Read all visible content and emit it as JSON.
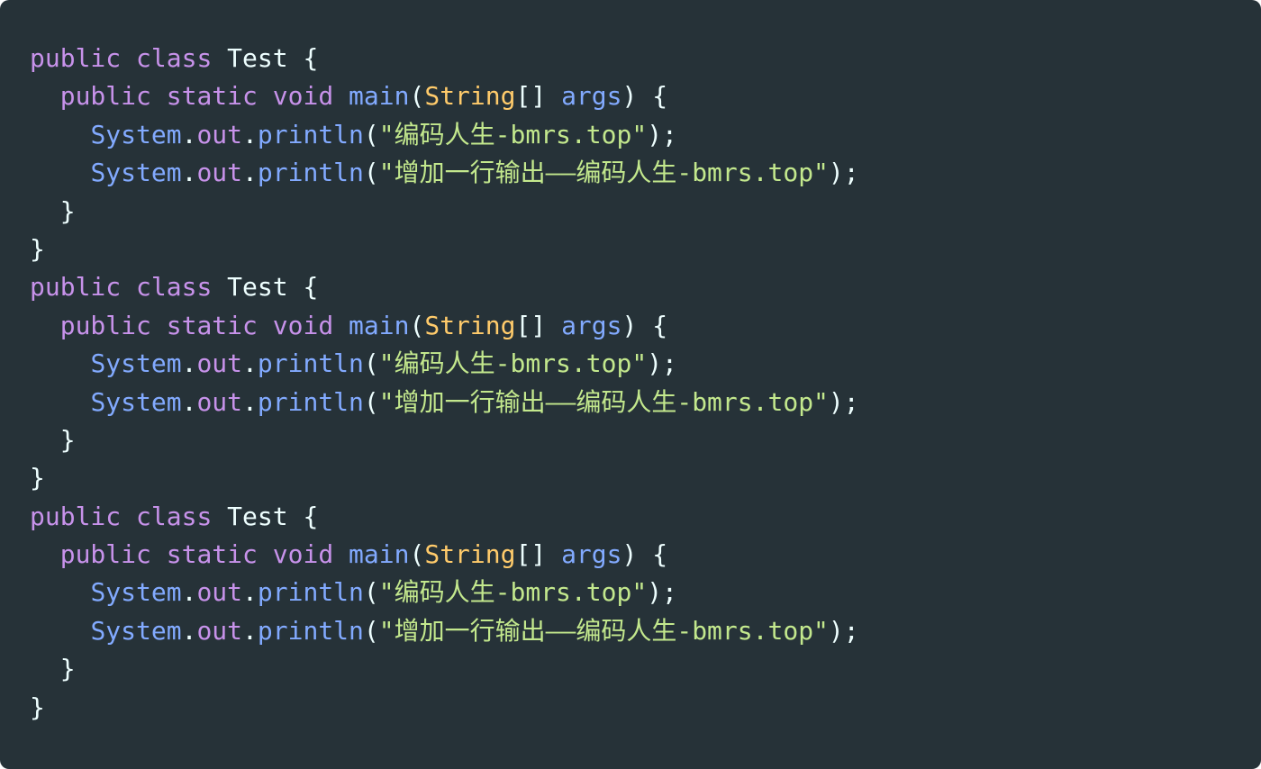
{
  "colors": {
    "background": "#263238",
    "keyword": "#c792ea",
    "type": "#ffcb6b",
    "function": "#82aaff",
    "string": "#c3e88d",
    "plain": "#eeffff"
  },
  "code": {
    "lines": [
      [
        {
          "t": "kw",
          "v": "public"
        },
        {
          "t": "plain",
          "v": " "
        },
        {
          "t": "kw",
          "v": "class"
        },
        {
          "t": "plain",
          "v": " Test {"
        }
      ],
      [
        {
          "t": "plain",
          "v": "  "
        },
        {
          "t": "kw",
          "v": "public"
        },
        {
          "t": "plain",
          "v": " "
        },
        {
          "t": "kw",
          "v": "static"
        },
        {
          "t": "plain",
          "v": " "
        },
        {
          "t": "kw",
          "v": "void"
        },
        {
          "t": "plain",
          "v": " "
        },
        {
          "t": "fn",
          "v": "main"
        },
        {
          "t": "plain",
          "v": "("
        },
        {
          "t": "type",
          "v": "String"
        },
        {
          "t": "plain",
          "v": "[] "
        },
        {
          "t": "fn",
          "v": "args"
        },
        {
          "t": "plain",
          "v": ") {"
        }
      ],
      [
        {
          "t": "plain",
          "v": "    "
        },
        {
          "t": "fn",
          "v": "System"
        },
        {
          "t": "plain",
          "v": "."
        },
        {
          "t": "kw",
          "v": "out"
        },
        {
          "t": "plain",
          "v": "."
        },
        {
          "t": "fn",
          "v": "println"
        },
        {
          "t": "plain",
          "v": "("
        },
        {
          "t": "str",
          "v": "\"编码人生-bmrs.top\""
        },
        {
          "t": "plain",
          "v": ");"
        }
      ],
      [
        {
          "t": "plain",
          "v": "    "
        },
        {
          "t": "fn",
          "v": "System"
        },
        {
          "t": "plain",
          "v": "."
        },
        {
          "t": "kw",
          "v": "out"
        },
        {
          "t": "plain",
          "v": "."
        },
        {
          "t": "fn",
          "v": "println"
        },
        {
          "t": "plain",
          "v": "("
        },
        {
          "t": "str",
          "v": "\"增加一行输出——编码人生-bmrs.top\""
        },
        {
          "t": "plain",
          "v": ");"
        }
      ],
      [
        {
          "t": "plain",
          "v": "  }"
        }
      ],
      [
        {
          "t": "plain",
          "v": "}"
        }
      ],
      [
        {
          "t": "kw",
          "v": "public"
        },
        {
          "t": "plain",
          "v": " "
        },
        {
          "t": "kw",
          "v": "class"
        },
        {
          "t": "plain",
          "v": " Test {"
        }
      ],
      [
        {
          "t": "plain",
          "v": "  "
        },
        {
          "t": "kw",
          "v": "public"
        },
        {
          "t": "plain",
          "v": " "
        },
        {
          "t": "kw",
          "v": "static"
        },
        {
          "t": "plain",
          "v": " "
        },
        {
          "t": "kw",
          "v": "void"
        },
        {
          "t": "plain",
          "v": " "
        },
        {
          "t": "fn",
          "v": "main"
        },
        {
          "t": "plain",
          "v": "("
        },
        {
          "t": "type",
          "v": "String"
        },
        {
          "t": "plain",
          "v": "[] "
        },
        {
          "t": "fn",
          "v": "args"
        },
        {
          "t": "plain",
          "v": ") {"
        }
      ],
      [
        {
          "t": "plain",
          "v": "    "
        },
        {
          "t": "fn",
          "v": "System"
        },
        {
          "t": "plain",
          "v": "."
        },
        {
          "t": "kw",
          "v": "out"
        },
        {
          "t": "plain",
          "v": "."
        },
        {
          "t": "fn",
          "v": "println"
        },
        {
          "t": "plain",
          "v": "("
        },
        {
          "t": "str",
          "v": "\"编码人生-bmrs.top\""
        },
        {
          "t": "plain",
          "v": ");"
        }
      ],
      [
        {
          "t": "plain",
          "v": "    "
        },
        {
          "t": "fn",
          "v": "System"
        },
        {
          "t": "plain",
          "v": "."
        },
        {
          "t": "kw",
          "v": "out"
        },
        {
          "t": "plain",
          "v": "."
        },
        {
          "t": "fn",
          "v": "println"
        },
        {
          "t": "plain",
          "v": "("
        },
        {
          "t": "str",
          "v": "\"增加一行输出——编码人生-bmrs.top\""
        },
        {
          "t": "plain",
          "v": ");"
        }
      ],
      [
        {
          "t": "plain",
          "v": "  }"
        }
      ],
      [
        {
          "t": "plain",
          "v": "}"
        }
      ],
      [
        {
          "t": "kw",
          "v": "public"
        },
        {
          "t": "plain",
          "v": " "
        },
        {
          "t": "kw",
          "v": "class"
        },
        {
          "t": "plain",
          "v": " Test {"
        }
      ],
      [
        {
          "t": "plain",
          "v": "  "
        },
        {
          "t": "kw",
          "v": "public"
        },
        {
          "t": "plain",
          "v": " "
        },
        {
          "t": "kw",
          "v": "static"
        },
        {
          "t": "plain",
          "v": " "
        },
        {
          "t": "kw",
          "v": "void"
        },
        {
          "t": "plain",
          "v": " "
        },
        {
          "t": "fn",
          "v": "main"
        },
        {
          "t": "plain",
          "v": "("
        },
        {
          "t": "type",
          "v": "String"
        },
        {
          "t": "plain",
          "v": "[] "
        },
        {
          "t": "fn",
          "v": "args"
        },
        {
          "t": "plain",
          "v": ") {"
        }
      ],
      [
        {
          "t": "plain",
          "v": "    "
        },
        {
          "t": "fn",
          "v": "System"
        },
        {
          "t": "plain",
          "v": "."
        },
        {
          "t": "kw",
          "v": "out"
        },
        {
          "t": "plain",
          "v": "."
        },
        {
          "t": "fn",
          "v": "println"
        },
        {
          "t": "plain",
          "v": "("
        },
        {
          "t": "str",
          "v": "\"编码人生-bmrs.top\""
        },
        {
          "t": "plain",
          "v": ");"
        }
      ],
      [
        {
          "t": "plain",
          "v": "    "
        },
        {
          "t": "fn",
          "v": "System"
        },
        {
          "t": "plain",
          "v": "."
        },
        {
          "t": "kw",
          "v": "out"
        },
        {
          "t": "plain",
          "v": "."
        },
        {
          "t": "fn",
          "v": "println"
        },
        {
          "t": "plain",
          "v": "("
        },
        {
          "t": "str",
          "v": "\"增加一行输出——编码人生-bmrs.top\""
        },
        {
          "t": "plain",
          "v": ");"
        }
      ],
      [
        {
          "t": "plain",
          "v": "  }"
        }
      ],
      [
        {
          "t": "plain",
          "v": "}"
        }
      ]
    ]
  }
}
